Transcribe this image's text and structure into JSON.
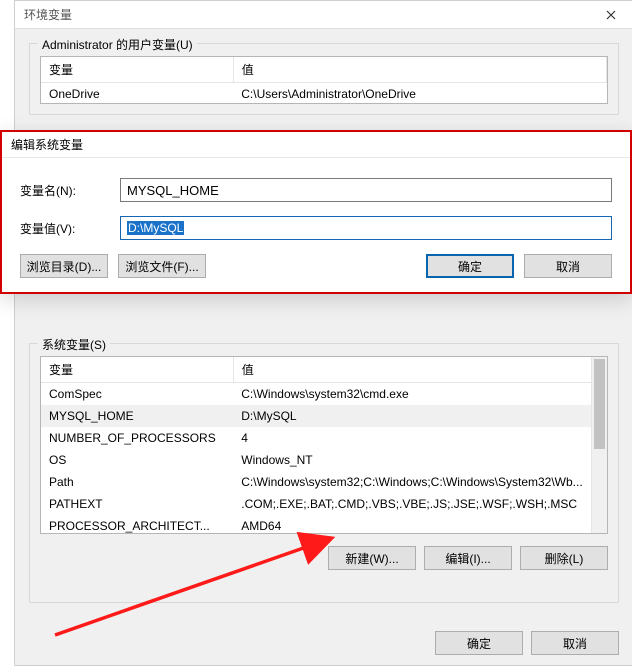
{
  "envwin": {
    "title": "环境变量",
    "user_group_title": "Administrator 的用户变量(U)",
    "sys_group_title": "系统变量(S)",
    "col_var": "变量",
    "col_val": "值",
    "user_rows": [
      {
        "name": "OneDrive",
        "value": "C:\\Users\\Administrator\\OneDrive"
      }
    ],
    "sys_rows": [
      {
        "name": "ComSpec",
        "value": "C:\\Windows\\system32\\cmd.exe"
      },
      {
        "name": "MYSQL_HOME",
        "value": "D:\\MySQL"
      },
      {
        "name": "NUMBER_OF_PROCESSORS",
        "value": "4"
      },
      {
        "name": "OS",
        "value": "Windows_NT"
      },
      {
        "name": "Path",
        "value": "C:\\Windows\\system32;C:\\Windows;C:\\Windows\\System32\\Wb..."
      },
      {
        "name": "PATHEXT",
        "value": ".COM;.EXE;.BAT;.CMD;.VBS;.VBE;.JS;.JSE;.WSF;.WSH;.MSC"
      },
      {
        "name": "PROCESSOR_ARCHITECT...",
        "value": "AMD64"
      }
    ],
    "btn_new": "新建(W)...",
    "btn_edit": "编辑(I)...",
    "btn_delete": "删除(L)",
    "btn_ok": "确定",
    "btn_cancel": "取消"
  },
  "editwin": {
    "title": "编辑系统变量",
    "label_name": "变量名(N):",
    "label_value": "变量值(V):",
    "name_value": "MYSQL_HOME",
    "value_value": "D:\\MySQL",
    "btn_browse_dir": "浏览目录(D)...",
    "btn_browse_file": "浏览文件(F)...",
    "btn_ok": "确定",
    "btn_cancel": "取消"
  }
}
